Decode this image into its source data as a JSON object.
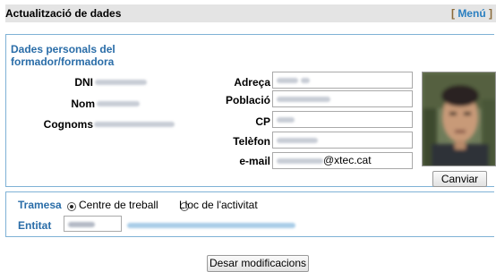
{
  "header": {
    "title": "Actualització de dades",
    "menu_open": "[",
    "menu_label": "Menú",
    "menu_close": "]"
  },
  "personal": {
    "section_title": "Dades personals del formador/formadora",
    "dni_label": "DNI",
    "nom_label": "Nom",
    "cognoms_label": "Cognoms",
    "adreca_label": "Adreça",
    "poblacio_label": "Població",
    "cp_label": "CP",
    "telefon_label": "Telèfon",
    "email_label": "e-mail",
    "email_domain": "@xtec.cat",
    "change_photo_button": "Canviar"
  },
  "delivery": {
    "tramesa_label": "Tramesa",
    "option_work": "Centre de treball",
    "option_activity": "Lloc de l'activitat",
    "selected": "Centre de treball",
    "entitat_label": "Entitat"
  },
  "save_button": "Desar modificacions",
  "colors": {
    "section_title": "#2a6da8",
    "panel_border": "#7fb2d6",
    "header_bg": "#e4e4e4",
    "menu_link": "#2a7fc0"
  }
}
